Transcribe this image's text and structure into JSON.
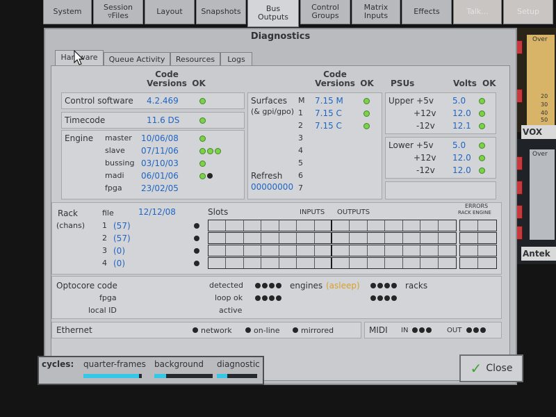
{
  "top_tabs": [
    {
      "label": "System"
    },
    {
      "label": "Session\n▿Files"
    },
    {
      "label": "Layout"
    },
    {
      "label": "Snapshots"
    },
    {
      "label": "Bus\nOutputs"
    },
    {
      "label": "Control\nGroups"
    },
    {
      "label": "Matrix\nInputs"
    },
    {
      "label": "Effects"
    },
    {
      "label": "Talk..."
    },
    {
      "label": "Setup"
    }
  ],
  "dialog": {
    "title": "Diagnostics",
    "tabs": [
      "Hardware",
      "Queue Activity",
      "Resources",
      "Logs"
    ],
    "code_versions_header": "Code\nVersions",
    "ok_header": "OK",
    "control_software": {
      "label": "Control software",
      "version": "4.2.469"
    },
    "timecode": {
      "label": "Timecode",
      "value": "11.6 DS"
    },
    "engine": {
      "label": "Engine",
      "rows": [
        {
          "name": "master",
          "version": "10/06/08"
        },
        {
          "name": "slave",
          "version": "07/11/06"
        },
        {
          "name": "bussing",
          "version": "03/10/03"
        },
        {
          "name": "madi",
          "version": "06/01/06"
        },
        {
          "name": "fpga",
          "version": "23/02/05"
        }
      ]
    },
    "surfaces": {
      "label": "Surfaces",
      "sublabel": "(& gpi/gpo)",
      "rows": [
        {
          "id": "M",
          "version": "7.15 M"
        },
        {
          "id": "1",
          "version": "7.15 C"
        },
        {
          "id": "2",
          "version": "7.15 C"
        },
        {
          "id": "3",
          "version": ""
        },
        {
          "id": "4",
          "version": ""
        },
        {
          "id": "5",
          "version": ""
        },
        {
          "id": "6",
          "version": ""
        },
        {
          "id": "7",
          "version": ""
        }
      ],
      "refresh_label": "Refresh",
      "refresh_value": "00000000"
    },
    "psus": {
      "label": "PSUs",
      "volts_header": "Volts",
      "upper": [
        {
          "name": "Upper +5v",
          "volts": "5.0"
        },
        {
          "name": "+12v",
          "volts": "12.0"
        },
        {
          "name": "-12v",
          "volts": "12.1"
        }
      ],
      "lower": [
        {
          "name": "Lower +5v",
          "volts": "5.0"
        },
        {
          "name": "+12v",
          "volts": "12.0"
        },
        {
          "name": "-12v",
          "volts": "12.0"
        }
      ]
    },
    "rack": {
      "label": "Rack",
      "sublabel": "(chans)",
      "file_label": "file",
      "file_value": "12/12/08",
      "slots_label": "Slots",
      "inputs_label": "INPUTS",
      "outputs_label": "OUTPUTS",
      "errors_label": "ERRORS",
      "rack_engine_label": "RACK ENGINE",
      "rows": [
        {
          "id": "1",
          "chans": "(57)"
        },
        {
          "id": "2",
          "chans": "(57)"
        },
        {
          "id": "3",
          "chans": "(0)"
        },
        {
          "id": "4",
          "chans": "(0)"
        }
      ]
    },
    "optocore": {
      "label": "Optocore code",
      "fpga": "fpga",
      "local_id": "local ID",
      "detected": "detected",
      "loop_ok": "loop ok",
      "active": "active",
      "engines": "engines",
      "asleep": "(asleep)",
      "racks": "racks"
    },
    "ethernet": {
      "label": "Ethernet",
      "network": "network",
      "online": "on-line",
      "mirrored": "mirrored"
    },
    "midi": {
      "label": "MIDI",
      "in": "IN",
      "out": "OUT"
    }
  },
  "cycles": {
    "label": "cycles:",
    "quarter_frames": "quarter-frames",
    "background": "background",
    "diagnostic": "diagnostic",
    "quarter_frames_level": 0.95,
    "background_level": 0.2,
    "diagnostic_level": 0.25
  },
  "close_button": {
    "label": "Close"
  },
  "right_strip": {
    "vox": "VOX",
    "antek": "Antek",
    "over": "Over",
    "scale": [
      "20",
      "30",
      "40",
      "50",
      "60"
    ]
  },
  "colors": {
    "green_led": "#7fcf4a",
    "blue_text": "#2065c4",
    "cyan_bar": "#33c7e8"
  }
}
